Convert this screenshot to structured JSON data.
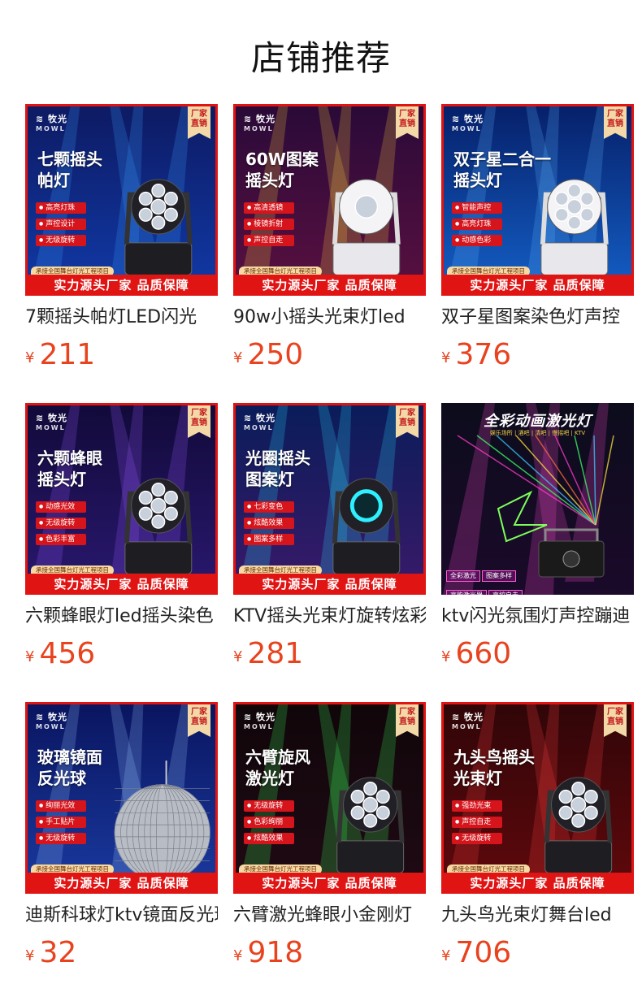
{
  "page_title": "店铺推荐",
  "brand": {
    "name": "牧光",
    "sub": "MOWL"
  },
  "badge": "厂家直销",
  "ticker": "承接全国舞台灯光工程项目",
  "banner": "实力源头厂家 品质保障",
  "currency": "¥",
  "products": [
    {
      "name": "7颗摇头帕灯LED闪光",
      "price": "211",
      "headline": "七颗摇头\n帕灯",
      "features": [
        "高亮灯珠",
        "声控设计",
        "无级旋转"
      ],
      "art": "par",
      "colors": {
        "top": "#0e1a63",
        "bottom": "#103aa8",
        "beam": "#3aa0ff"
      }
    },
    {
      "name": "90w小摇头光束灯led",
      "price": "250",
      "headline": "60W图案\n摇头灯",
      "features": [
        "高清透镜",
        "棱镜折射",
        "声控自走"
      ],
      "art": "spot",
      "colors": {
        "top": "#2a0a38",
        "bottom": "#5a1040",
        "beam": "#ffd23a"
      }
    },
    {
      "name": "双子星图案染色灯声控",
      "price": "376",
      "headline": "双子星二合一\n摇头灯",
      "features": [
        "智能声控",
        "高亮灯珠",
        "动感色彩"
      ],
      "art": "twin",
      "colors": {
        "top": "#06206a",
        "bottom": "#1460c8",
        "beam": "#5fb8ff"
      }
    },
    {
      "name": "六颗蜂眼灯led摇头染色",
      "price": "456",
      "headline": "六颗蜂眼\n摇头灯",
      "features": [
        "动感光效",
        "无级旋转",
        "色彩丰富"
      ],
      "art": "bee",
      "colors": {
        "top": "#120a3a",
        "bottom": "#2a1870",
        "beam": "#9a5bff"
      }
    },
    {
      "name": "KTV摇头光束灯旋转炫彩",
      "price": "281",
      "headline": "光圈摇头\n图案灯",
      "features": [
        "七彩变色",
        "炫酷效果",
        "图案多样"
      ],
      "art": "ring",
      "colors": {
        "top": "#0a1c5a",
        "bottom": "#3a1a6a",
        "beam": "#28e0ff"
      }
    },
    {
      "name": "ktv闪光氛围灯声控蹦迪",
      "price": "660",
      "laser_title": "全彩动画激光灯",
      "laser_sub": "娱乐场所 | 酒吧 | 清吧 | 慢摇吧 | KTV",
      "laser_tags": [
        "全彩激光",
        "图案多样",
        "高能激光器",
        "声控自走"
      ],
      "art": "laser",
      "colors": {
        "top": "#0c0c1c",
        "bottom": "#1b0a2a",
        "beam": "#ff4fd0"
      }
    },
    {
      "name": "迪斯科球灯ktv镜面反光球",
      "price": "32",
      "headline": "玻璃镜面\n反光球",
      "features": [
        "绚丽光效",
        "手工贴片",
        "无级旋转"
      ],
      "art": "ball",
      "colors": {
        "top": "#0a1560",
        "bottom": "#1a3aa0",
        "beam": "#9cc8ff"
      }
    },
    {
      "name": "六臂激光蜂眼小金刚灯",
      "price": "918",
      "headline": "六臂旋风\n激光灯",
      "features": [
        "无级旋转",
        "色彩绚丽",
        "炫酷效果"
      ],
      "art": "six",
      "colors": {
        "top": "#10060a",
        "bottom": "#200a14",
        "beam": "#39ff5a"
      }
    },
    {
      "name": "九头鸟光束灯舞台led",
      "price": "706",
      "headline": "九头鸟摇头\n光束灯",
      "features": [
        "强劲光束",
        "声控自走",
        "无级旋转"
      ],
      "art": "nine",
      "colors": {
        "top": "#300608",
        "bottom": "#60080c",
        "beam": "#ff4040"
      }
    }
  ]
}
